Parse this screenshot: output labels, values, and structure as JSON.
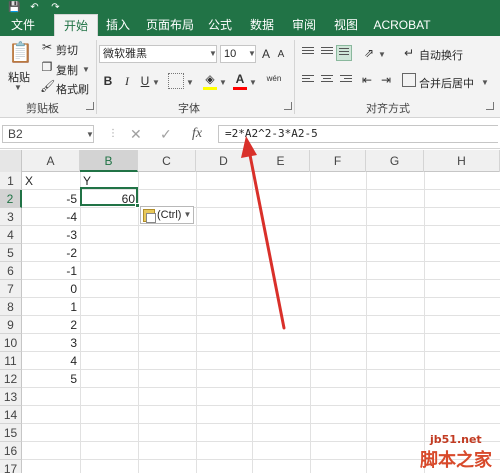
{
  "quick_access": {
    "save_icon": "save-icon",
    "undo_icon": "undo-icon",
    "redo_icon": "redo-icon"
  },
  "tabs": [
    {
      "label": "文件"
    },
    {
      "label": "开始"
    },
    {
      "label": "插入"
    },
    {
      "label": "页面布局"
    },
    {
      "label": "公式"
    },
    {
      "label": "数据"
    },
    {
      "label": "审阅"
    },
    {
      "label": "视图"
    },
    {
      "label": "ACROBAT"
    }
  ],
  "ribbon": {
    "clipboard": {
      "paste": "粘贴",
      "cut": "剪切",
      "copy": "复制",
      "format_painter": "格式刷",
      "group_label": "剪贴板"
    },
    "font": {
      "font_name": "微软雅黑",
      "font_size": "10",
      "bold": "B",
      "italic": "I",
      "underline": "U",
      "grow": "A",
      "shrink": "A",
      "font_color_letter": "A",
      "phonetic": "wén",
      "group_label": "字体"
    },
    "alignment": {
      "wrap_text": "自动换行",
      "merge_center": "合并后居中",
      "group_label": "对齐方式"
    },
    "colors": {
      "accent": "#217346",
      "highlight_yellow": "#ffff00",
      "font_red": "#ff0000"
    }
  },
  "formula_bar": {
    "name_box": "B2",
    "fx_label": "fx",
    "formula": "=2*A2^2-3*A2-5"
  },
  "grid": {
    "columns": [
      "A",
      "B",
      "C",
      "D",
      "E",
      "F",
      "G",
      "H"
    ],
    "rows": [
      "1",
      "2",
      "3",
      "4",
      "5",
      "6",
      "7",
      "8",
      "9",
      "10",
      "11",
      "12",
      "13",
      "14",
      "15",
      "16",
      "17"
    ],
    "header_row": {
      "A": "X",
      "B": "Y"
    },
    "a_values": [
      "-5",
      "-4",
      "-3",
      "-2",
      "-1",
      "0",
      "1",
      "2",
      "3",
      "4",
      "5"
    ],
    "b2_value": "60",
    "selected_cell": "B2"
  },
  "paste_options": {
    "label": "(Ctrl)"
  },
  "watermark": {
    "site": "jb51.net",
    "brand": "脚本之家"
  }
}
